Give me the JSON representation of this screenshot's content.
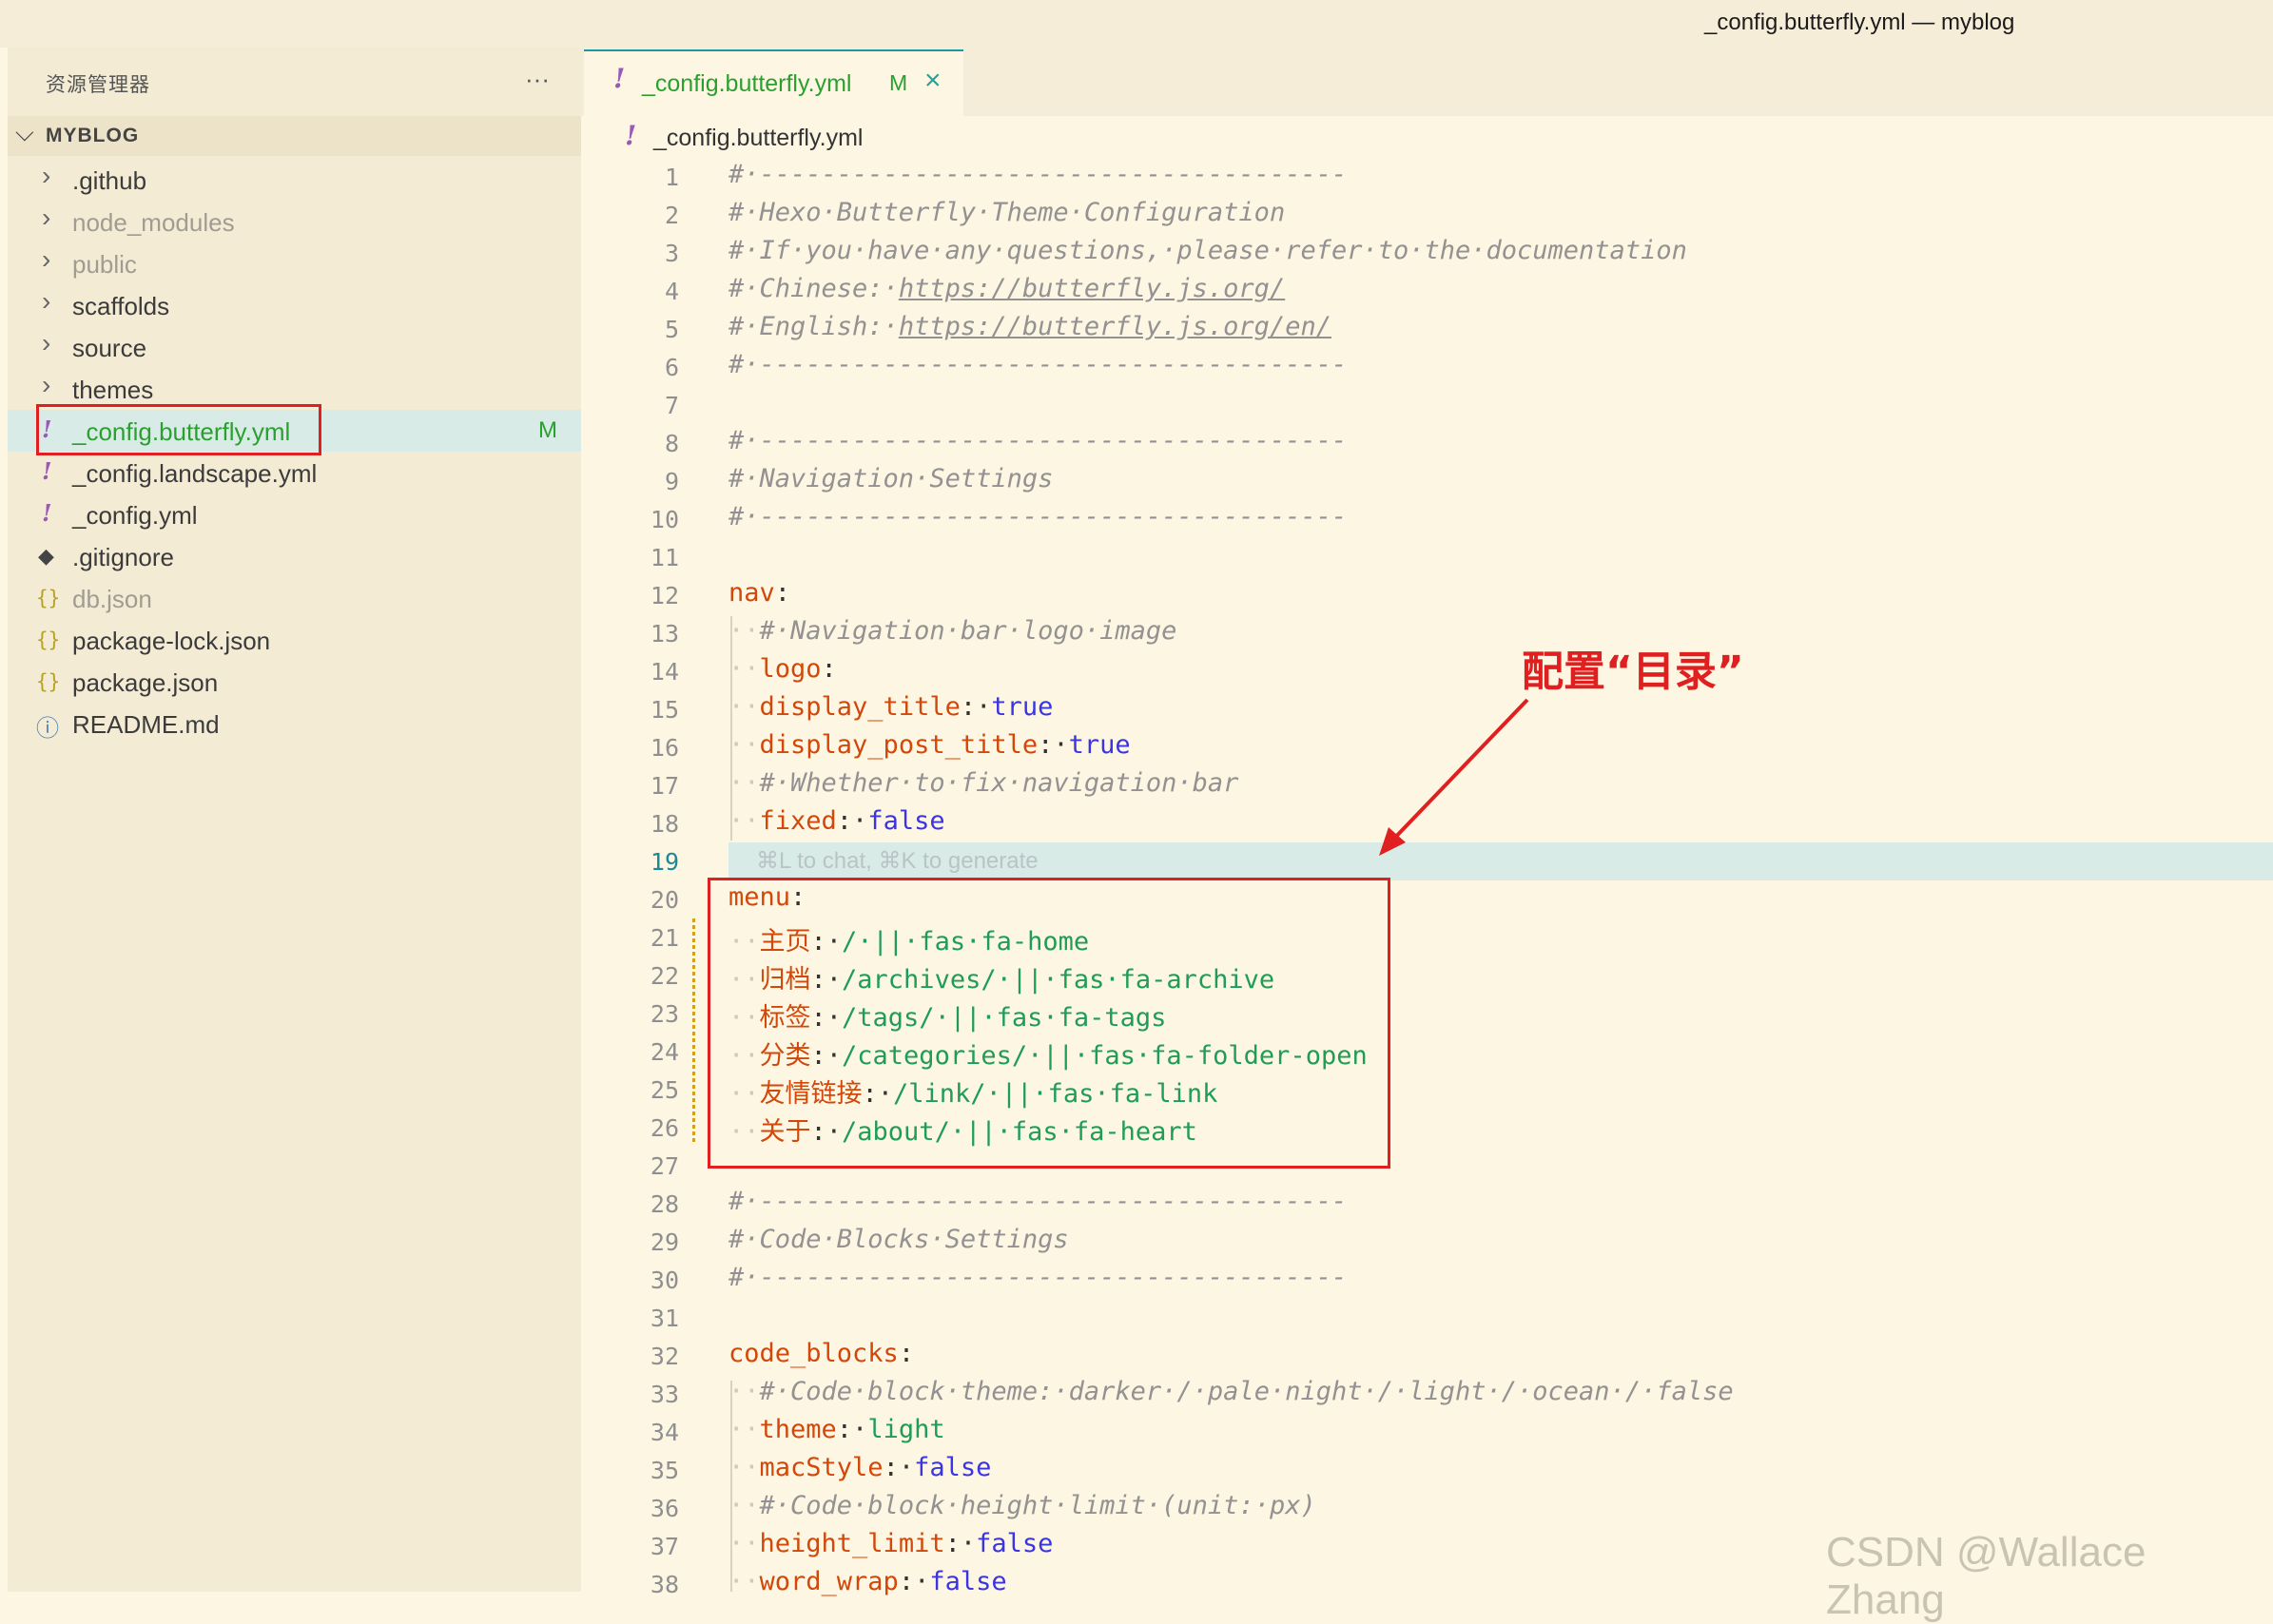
{
  "window": {
    "title": "_config.butterfly.yml — myblog"
  },
  "sidebar": {
    "explorer_title": "资源管理器",
    "more_icon": "···",
    "section_title": "MYBLOG",
    "items": [
      {
        "label": ".github",
        "icon": "chevron-right-icon",
        "glyph": "›",
        "dim": false
      },
      {
        "label": "node_modules",
        "icon": "chevron-right-icon",
        "glyph": "›",
        "dim": true
      },
      {
        "label": "public",
        "icon": "chevron-right-icon",
        "glyph": "›",
        "dim": true
      },
      {
        "label": "scaffolds",
        "icon": "chevron-right-icon",
        "glyph": "›",
        "dim": false
      },
      {
        "label": "source",
        "icon": "chevron-right-icon",
        "glyph": "›",
        "dim": false
      },
      {
        "label": "themes",
        "icon": "chevron-right-icon",
        "glyph": "›",
        "dim": false
      },
      {
        "label": "_config.butterfly.yml",
        "icon": "yaml-file-icon",
        "glyph": "!",
        "selected": true,
        "badge": "M"
      },
      {
        "label": "_config.landscape.yml",
        "icon": "yaml-file-icon",
        "glyph": "!"
      },
      {
        "label": "_config.yml",
        "icon": "yaml-file-icon",
        "glyph": "!"
      },
      {
        "label": ".gitignore",
        "icon": "git-icon",
        "glyph": "◆"
      },
      {
        "label": "db.json",
        "icon": "json-file-icon",
        "glyph": "{}",
        "dim": true
      },
      {
        "label": "package-lock.json",
        "icon": "json-file-icon",
        "glyph": "{}"
      },
      {
        "label": "package.json",
        "icon": "json-file-icon",
        "glyph": "{}"
      },
      {
        "label": "README.md",
        "icon": "info-icon",
        "glyph": "ⓘ"
      }
    ]
  },
  "tab": {
    "excl": "!",
    "label": "_config.butterfly.yml",
    "modified": "M",
    "close": "×"
  },
  "breadcrumb": {
    "excl": "!",
    "label": "_config.butterfly.yml"
  },
  "editor": {
    "ghost_text": "⌘L to chat, ⌘K to generate",
    "lines": [
      {
        "n": "1",
        "segs": [
          [
            "cmt",
            "#·--------------------------------------"
          ]
        ]
      },
      {
        "n": "2",
        "segs": [
          [
            "cmt",
            "#·Hexo·Butterfly·Theme·Configuration"
          ]
        ]
      },
      {
        "n": "3",
        "segs": [
          [
            "cmt",
            "#·If·you·have·any·questions,·please·refer·to·the·documentation"
          ]
        ]
      },
      {
        "n": "4",
        "segs": [
          [
            "cmt",
            "#·Chinese:·"
          ],
          [
            "link",
            "https://butterfly.js.org/"
          ]
        ]
      },
      {
        "n": "5",
        "segs": [
          [
            "cmt",
            "#·English:·"
          ],
          [
            "link",
            "https://butterfly.js.org/en/"
          ]
        ]
      },
      {
        "n": "6",
        "segs": [
          [
            "cmt",
            "#·--------------------------------------"
          ]
        ]
      },
      {
        "n": "7",
        "segs": []
      },
      {
        "n": "8",
        "segs": [
          [
            "cmt",
            "#·--------------------------------------"
          ]
        ]
      },
      {
        "n": "9",
        "segs": [
          [
            "cmt",
            "#·Navigation·Settings"
          ]
        ]
      },
      {
        "n": "10",
        "segs": [
          [
            "cmt",
            "#·--------------------------------------"
          ]
        ]
      },
      {
        "n": "11",
        "segs": []
      },
      {
        "n": "12",
        "segs": [
          [
            "key",
            "nav"
          ],
          [
            "punct",
            ":"
          ]
        ]
      },
      {
        "n": "13",
        "segs": [
          [
            "dot",
            "··"
          ],
          [
            "cmt",
            "#·Navigation·bar·logo·image"
          ]
        ]
      },
      {
        "n": "14",
        "segs": [
          [
            "dot",
            "··"
          ],
          [
            "key",
            "logo"
          ],
          [
            "punct",
            ":"
          ]
        ]
      },
      {
        "n": "15",
        "segs": [
          [
            "dot",
            "··"
          ],
          [
            "key",
            "display_title"
          ],
          [
            "punct",
            ":·"
          ],
          [
            "vbool",
            "true"
          ]
        ]
      },
      {
        "n": "16",
        "segs": [
          [
            "dot",
            "··"
          ],
          [
            "key",
            "display_post_title"
          ],
          [
            "punct",
            ":·"
          ],
          [
            "vbool",
            "true"
          ]
        ]
      },
      {
        "n": "17",
        "segs": [
          [
            "dot",
            "··"
          ],
          [
            "cmt",
            "#·Whether·to·fix·navigation·bar"
          ]
        ]
      },
      {
        "n": "18",
        "segs": [
          [
            "dot",
            "··"
          ],
          [
            "key",
            "fixed"
          ],
          [
            "punct",
            ":·"
          ],
          [
            "vbool",
            "false"
          ]
        ]
      },
      {
        "n": "19",
        "segs": [],
        "current": true
      },
      {
        "n": "20",
        "segs": [
          [
            "key",
            "menu"
          ],
          [
            "punct",
            ":"
          ]
        ]
      },
      {
        "n": "21",
        "segs": [
          [
            "dot",
            "··"
          ],
          [
            "key",
            "主页"
          ],
          [
            "punct",
            ":·"
          ],
          [
            "vstr",
            "/·||·fas·fa-home"
          ]
        ]
      },
      {
        "n": "22",
        "segs": [
          [
            "dot",
            "··"
          ],
          [
            "key",
            "归档"
          ],
          [
            "punct",
            ":·"
          ],
          [
            "vstr",
            "/archives/·||·fas·fa-archive"
          ]
        ]
      },
      {
        "n": "23",
        "segs": [
          [
            "dot",
            "··"
          ],
          [
            "key",
            "标签"
          ],
          [
            "punct",
            ":·"
          ],
          [
            "vstr",
            "/tags/·||·fas·fa-tags"
          ]
        ]
      },
      {
        "n": "24",
        "segs": [
          [
            "dot",
            "··"
          ],
          [
            "key",
            "分类"
          ],
          [
            "punct",
            ":·"
          ],
          [
            "vstr",
            "/categories/·||·fas·fa-folder-open"
          ]
        ]
      },
      {
        "n": "25",
        "segs": [
          [
            "dot",
            "··"
          ],
          [
            "key",
            "友情链接"
          ],
          [
            "punct",
            ":·"
          ],
          [
            "vstr",
            "/link/·||·fas·fa-link"
          ]
        ]
      },
      {
        "n": "26",
        "segs": [
          [
            "dot",
            "··"
          ],
          [
            "key",
            "关于"
          ],
          [
            "punct",
            ":·"
          ],
          [
            "vstr",
            "/about/·||·fas·fa-heart"
          ]
        ]
      },
      {
        "n": "27",
        "segs": []
      },
      {
        "n": "28",
        "segs": [
          [
            "cmt",
            "#·--------------------------------------"
          ]
        ]
      },
      {
        "n": "29",
        "segs": [
          [
            "cmt",
            "#·Code·Blocks·Settings"
          ]
        ]
      },
      {
        "n": "30",
        "segs": [
          [
            "cmt",
            "#·--------------------------------------"
          ]
        ]
      },
      {
        "n": "31",
        "segs": []
      },
      {
        "n": "32",
        "segs": [
          [
            "key",
            "code_blocks"
          ],
          [
            "punct",
            ":"
          ]
        ]
      },
      {
        "n": "33",
        "segs": [
          [
            "dot",
            "··"
          ],
          [
            "cmt",
            "#·Code·block·theme:·darker·/·pale·night·/·light·/·ocean·/·false"
          ]
        ]
      },
      {
        "n": "34",
        "segs": [
          [
            "dot",
            "··"
          ],
          [
            "key",
            "theme"
          ],
          [
            "punct",
            ":·"
          ],
          [
            "vstr",
            "light"
          ]
        ]
      },
      {
        "n": "35",
        "segs": [
          [
            "dot",
            "··"
          ],
          [
            "key",
            "macStyle"
          ],
          [
            "punct",
            ":·"
          ],
          [
            "vbool",
            "false"
          ]
        ]
      },
      {
        "n": "36",
        "segs": [
          [
            "dot",
            "··"
          ],
          [
            "cmt",
            "#·Code·block·height·limit·(unit:·px)"
          ]
        ]
      },
      {
        "n": "37",
        "segs": [
          [
            "dot",
            "··"
          ],
          [
            "key",
            "height_limit"
          ],
          [
            "punct",
            ":·"
          ],
          [
            "vbool",
            "false"
          ]
        ]
      },
      {
        "n": "38",
        "segs": [
          [
            "dot",
            "··"
          ],
          [
            "key",
            "word_wrap"
          ],
          [
            "punct",
            ":·"
          ],
          [
            "vbool",
            "false"
          ]
        ]
      }
    ]
  },
  "annotation": {
    "text": "配置“目录”"
  },
  "watermark": {
    "text": "CSDN @Wallace Zhang"
  },
  "colors": {
    "accent": "#1a9aa0",
    "highlight": "#e02020",
    "modified": "#2aa02f"
  }
}
